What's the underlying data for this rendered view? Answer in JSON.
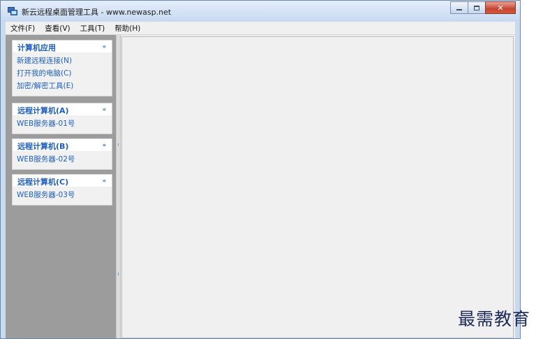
{
  "window": {
    "title": "新云远程桌面管理工具 - www.newasp.net",
    "controls": {
      "minimize": "–",
      "maximize": "□",
      "close": "✕"
    }
  },
  "menu": [
    "文件(F)",
    "查看(V)",
    "工具(T)",
    "帮助(H)"
  ],
  "sidebar": {
    "panels": [
      {
        "title": "计算机应用",
        "collapse": "«",
        "items": [
          "新建远程连接(N)",
          "打开我的电脑(C)",
          "加密/解密工具(E)"
        ]
      },
      {
        "title": "远程计算机(A)",
        "collapse": "«",
        "items": [
          "WEB服务器-01号"
        ]
      },
      {
        "title": "远程计算机(B)",
        "collapse": "«",
        "items": [
          "WEB服务器-02号"
        ]
      },
      {
        "title": "远程计算机(C)",
        "collapse": "«",
        "items": [
          "WEB服务器-03号"
        ]
      }
    ]
  },
  "watermark": "最需教育",
  "colors": {
    "accent": "#1f5fbf",
    "sidebar_bg": "#9c9c9c",
    "close_button": "#c5452f"
  }
}
